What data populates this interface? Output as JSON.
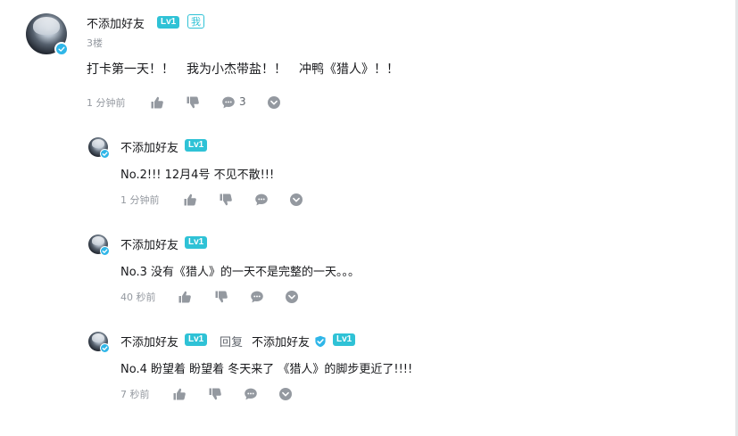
{
  "colors": {
    "level_badge": "#2fc2d6",
    "verified_badge": "#2fb6e8",
    "meta_text": "#9499a0",
    "action_icon": "#9499a0"
  },
  "icons": {
    "like": "thumbs-up-icon",
    "dislike": "thumbs-down-icon",
    "reply": "speech-bubble-icon",
    "more": "chevron-down-circle-icon",
    "verified": "shield-check-icon"
  },
  "main_comment": {
    "username": "不添加好友",
    "level": "Lv1",
    "me_tag": "我",
    "floor": "3楼",
    "content": "打卡第一天！！　我为小杰带盐！！　冲鸭《猎人》！！",
    "time": "1 分钟前",
    "reply_count": "3"
  },
  "replies": [
    {
      "username": "不添加好友",
      "level": "Lv1",
      "content": "No.2!!! 12月4号 不见不散!!!",
      "time": "1 分钟前"
    },
    {
      "username": "不添加好友",
      "level": "Lv1",
      "content": "No.3 没有《猎人》的一天不是完整的一天。。。",
      "time": "40 秒前"
    },
    {
      "username": "不添加好友",
      "level": "Lv1",
      "reply_word": "回复",
      "reply_to_username": "不添加好友",
      "reply_to_level": "Lv1",
      "content": "No.4 盼望着 盼望着 冬天来了 《猎人》的脚步更近了!!!!",
      "time": "7 秒前"
    }
  ]
}
